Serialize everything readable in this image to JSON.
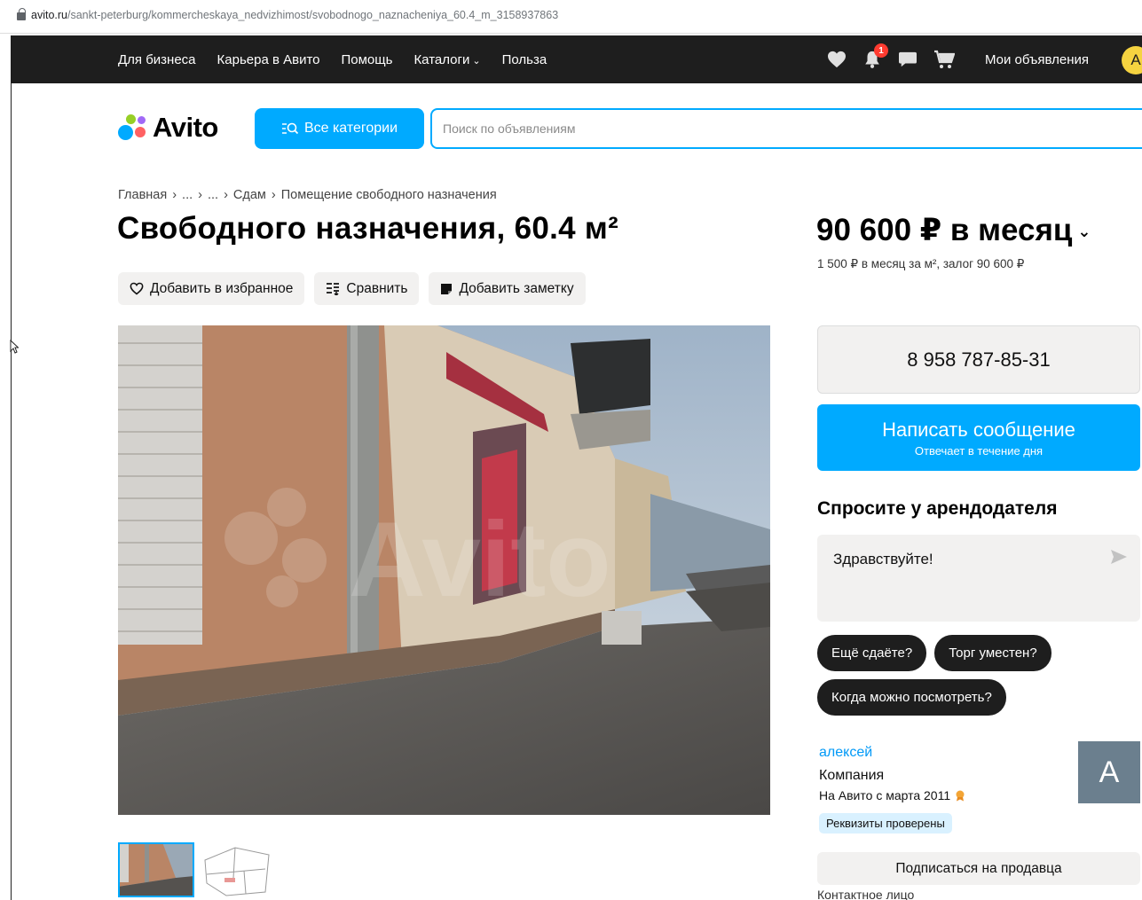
{
  "browser": {
    "url_host": "avito.ru",
    "url_path": "/sankt-peterburg/kommercheskaya_nedvizhimost/svobodnogo_naznacheniya_60.4_m_3158937863"
  },
  "topnav": {
    "links": [
      "Для бизнеса",
      "Карьера в Авито",
      "Помощь",
      "Каталоги",
      "Польза"
    ],
    "notifications_count": "1",
    "my_ads": "Мои объявления",
    "user_initial": "А"
  },
  "header": {
    "logo_text": "Avito",
    "categories_button": "Все категории",
    "search_placeholder": "Поиск по объявлениям"
  },
  "breadcrumbs": [
    "Главная",
    "...",
    "...",
    "Сдам",
    "Помещение свободного назначения"
  ],
  "listing": {
    "title": "Свободного назначения, 60.4 м²",
    "actions": {
      "favorite": "Добавить в избранное",
      "compare": "Сравнить",
      "note": "Добавить заметку"
    }
  },
  "pricing": {
    "price": "90 600 ₽ в месяц",
    "subline": "1 500 ₽ в месяц за м², залог 90 600 ₽"
  },
  "contact": {
    "phone": "8 958 787-85-31",
    "message_button": "Написать сообщение",
    "message_sub": "Отвечает в течение дня"
  },
  "ask": {
    "title": "Спросите у арендодателя",
    "message": "Здравствуйте!",
    "chips": [
      "Ещё сдаёте?",
      "Торг уместен?",
      "Когда можно посмотреть?"
    ]
  },
  "seller": {
    "name": "алексей",
    "type": "Компания",
    "since": "На Авито с марта 2011",
    "verified": "Реквизиты проверены",
    "avatar_initial": "А",
    "subscribe": "Подписаться на продавца",
    "contact_person": "Контактное лицо"
  },
  "colors": {
    "accent": "#00aaff",
    "nav_bg": "#1e1e1e",
    "chip_bg": "#1e1e1e",
    "button_gray": "#f2f1f0",
    "seller_link": "#0099f7",
    "notification_red": "#ff3b30"
  }
}
